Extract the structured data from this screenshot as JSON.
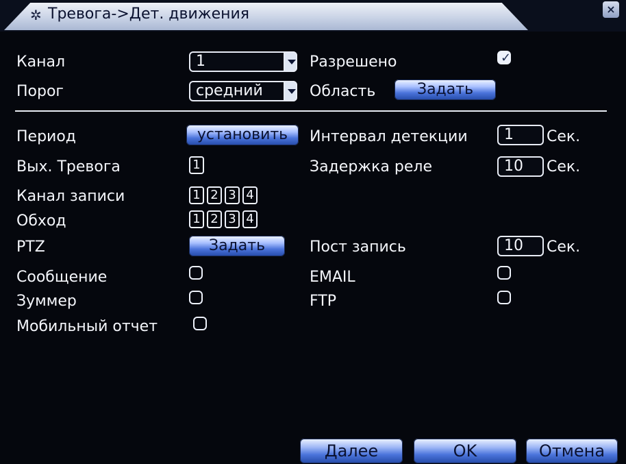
{
  "window": {
    "title": "Тревога->Дет. движения",
    "title_icon": "gear-icon",
    "close_label": "×"
  },
  "fields": {
    "channel_label": "Канал",
    "channel_value": "1",
    "enabled_label": "Разрешено",
    "enabled_checked": true,
    "threshold_label": "Порог",
    "threshold_value": "средний",
    "area_label": "Область",
    "area_button": "Задать",
    "period_label": "Период",
    "period_button": "установить",
    "detect_interval_label": "Интервал детекции",
    "detect_interval_value": "1",
    "detect_interval_unit": "Сек.",
    "alarm_out_label": "Вых. Тревога",
    "alarm_out_boxes": [
      "1"
    ],
    "relay_delay_label": "Задержка реле",
    "relay_delay_value": "10",
    "relay_delay_unit": "Сек.",
    "record_channel_label": "Канал записи",
    "record_channel_boxes": [
      "1",
      "2",
      "3",
      "4"
    ],
    "tour_label": "Обход",
    "tour_boxes": [
      "1",
      "2",
      "3",
      "4"
    ],
    "ptz_label": "PTZ",
    "ptz_button": "Задать",
    "post_record_label": "Пост запись",
    "post_record_value": "10",
    "post_record_unit": "Сек.",
    "message_label": "Сообщение",
    "email_label": "EMAIL",
    "buzzer_label": "Зуммер",
    "ftp_label": "FTP",
    "mobile_report_label": "Мобильный отчет"
  },
  "footer": {
    "next": "Далее",
    "ok": "OK",
    "cancel": "Отмена"
  }
}
